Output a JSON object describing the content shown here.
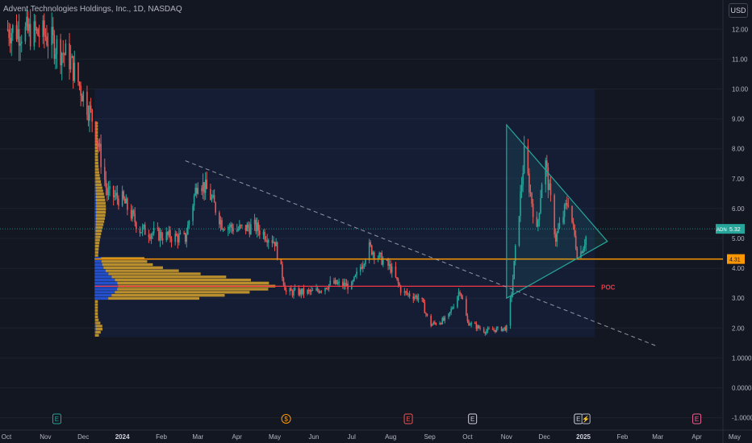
{
  "header": {
    "title": "Advent Technologies Holdings, Inc., 1D, NASDAQ",
    "currency": "USD"
  },
  "colors": {
    "background": "#131722",
    "up": "#26a69a",
    "down": "#ef5350",
    "volume_profile_blue": "#2962ff",
    "volume_profile_yellow": "#f0b429",
    "poc": "#f23645",
    "orange_line": "#ff9800",
    "triangle": "#26a69a",
    "trend": "#b2b5be"
  },
  "chart_data": {
    "type": "candlestick",
    "title": "Advent Technologies Holdings, Inc., 1D, NASDAQ",
    "ylim": [
      -1.2,
      12.8
    ],
    "y_ticks": [
      "12.00",
      "11.00",
      "10.00",
      "9.00",
      "8.00",
      "7.00",
      "6.00",
      "5.00",
      "4.00",
      "3.00",
      "2.00",
      "1.0000",
      "0.0000",
      "-1.0000"
    ],
    "x_ticks": [
      "Oct",
      "Nov",
      "Dec",
      "2024",
      "Feb",
      "Mar",
      "Apr",
      "May",
      "Jun",
      "Jul",
      "Aug",
      "Sep",
      "Oct",
      "Nov",
      "Dec",
      "2025",
      "Feb",
      "Mar",
      "Apr",
      "May"
    ],
    "price_path": [
      [
        "2023-10-01",
        12.0
      ],
      [
        "2023-11-01",
        11.8
      ],
      [
        "2023-11-20",
        11.0
      ],
      [
        "2023-12-01",
        9.8
      ],
      [
        "2023-12-10",
        8.8
      ],
      [
        "2023-12-20",
        6.5
      ],
      [
        "2024-01-01",
        6.3
      ],
      [
        "2024-01-15",
        5.3
      ],
      [
        "2024-02-01",
        5.1
      ],
      [
        "2024-02-20",
        5.0
      ],
      [
        "2024-03-01",
        7.0
      ],
      [
        "2024-03-10",
        6.5
      ],
      [
        "2024-03-20",
        5.5
      ],
      [
        "2024-04-01",
        5.3
      ],
      [
        "2024-04-15",
        5.4
      ],
      [
        "2024-05-01",
        4.9
      ],
      [
        "2024-05-10",
        3.2
      ],
      [
        "2024-06-01",
        3.2
      ],
      [
        "2024-06-15",
        3.5
      ],
      [
        "2024-07-01",
        3.4
      ],
      [
        "2024-07-15",
        4.7
      ],
      [
        "2024-08-01",
        4.0
      ],
      [
        "2024-08-10",
        3.2
      ],
      [
        "2024-08-25",
        3.0
      ],
      [
        "2024-09-01",
        2.1
      ],
      [
        "2024-09-15",
        2.3
      ],
      [
        "2024-09-25",
        3.3
      ],
      [
        "2024-10-01",
        2.2
      ],
      [
        "2024-10-15",
        1.9
      ],
      [
        "2024-11-01",
        2.0
      ],
      [
        "2024-11-05",
        3.2
      ],
      [
        "2024-11-15",
        7.8
      ],
      [
        "2024-11-25",
        5.2
      ],
      [
        "2024-12-01",
        7.8
      ],
      [
        "2024-12-10",
        5.0
      ],
      [
        "2024-12-20",
        6.3
      ],
      [
        "2024-12-28",
        4.3
      ],
      [
        "2025-01-05",
        5.3
      ]
    ],
    "current_price": "5.32",
    "current_label": "ADN",
    "horizontal_levels": [
      {
        "name": "orange level",
        "value": 4.31,
        "label": "4.31"
      },
      {
        "name": "POC",
        "value": 3.4,
        "label": "POC"
      }
    ],
    "trendlines": [
      {
        "name": "descending dashed",
        "start": [
          "2024-02-20",
          7.6
        ],
        "end": [
          "2025-02-28",
          1.4
        ]
      },
      {
        "name": "triangle",
        "points": [
          [
            "2024-11-01",
            8.8
          ],
          [
            "2025-01-20",
            4.9
          ],
          [
            "2024-11-01",
            3.0
          ]
        ]
      }
    ],
    "volume_profile": {
      "range": [
        1.7,
        8.9
      ],
      "poc": 3.4
    },
    "events": [
      {
        "date": "2023-11-10",
        "label": "E"
      },
      {
        "date": "2024-05-10",
        "label": "$"
      },
      {
        "date": "2024-08-15",
        "label": "E"
      },
      {
        "date": "2024-10-05",
        "label": "E"
      },
      {
        "date": "2024-12-28",
        "label": "E"
      },
      {
        "date": "2025-01-03",
        "label": "⚡"
      },
      {
        "date": "2025-04-01",
        "label": "E"
      }
    ]
  }
}
